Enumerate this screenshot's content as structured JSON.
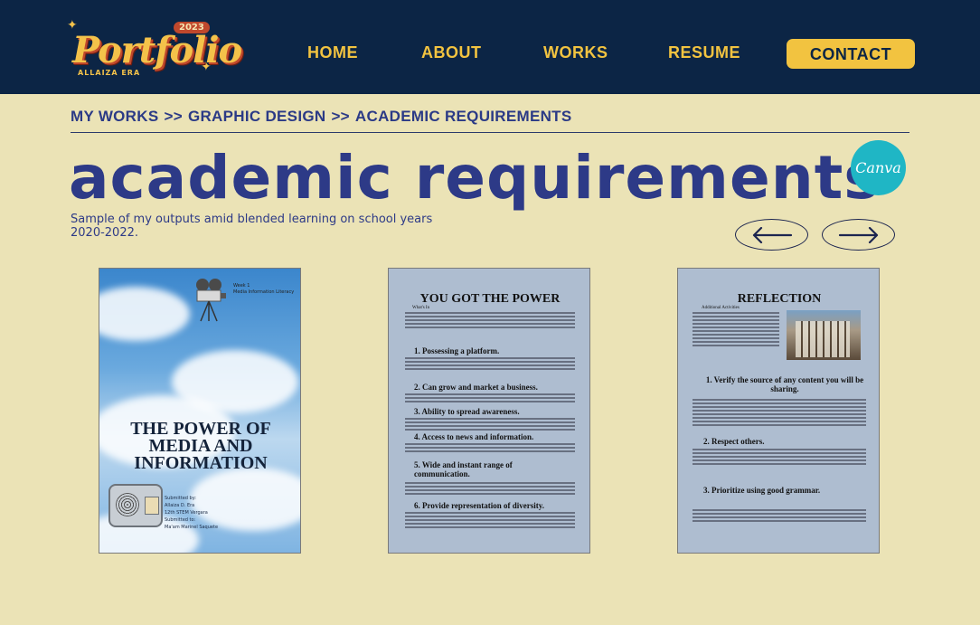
{
  "header": {
    "logo": {
      "word": "Portfolio",
      "year": "2023",
      "sub": "ALLAIZA ERA"
    },
    "nav": [
      "HOME",
      "ABOUT",
      "WORKS",
      "RESUME"
    ],
    "contact_label": "CONTACT"
  },
  "breadcrumb": [
    "MY WORKS",
    ">>",
    "GRAPHIC DESIGN",
    ">>",
    "ACADEMIC REQUIREMENTS"
  ],
  "page_title": "academic requirements",
  "canva_label": "Canva",
  "subtitle": "Sample of my outputs amid blended learning on school years 2020-2022.",
  "cards": {
    "cover": {
      "module": "Week 1",
      "module_sub": "Media Information Literacy",
      "title_lines": [
        "THE POWER OF",
        "MEDIA AND",
        "INFORMATION"
      ],
      "credits": [
        "Submitted by:",
        "Allaiza D. Era",
        "12th STEM Vergara",
        "Submitted to:",
        "Ma'am Marinel Saquete"
      ]
    },
    "power": {
      "title": "YOU GOT THE POWER",
      "intro_label": "What's In",
      "items": [
        "1. Possessing a platform.",
        "2. Can grow and market a business.",
        "3. Ability to spread awareness.",
        "4. Access to news and information.",
        "5. Wide and instant range of communication.",
        "6. Provide representation of diversity."
      ]
    },
    "reflection": {
      "title": "REFLECTION",
      "intro_label": "Additional Activities",
      "items": [
        "1. Verify the source of any content you will be sharing.",
        "2. Respect others.",
        "3. Prioritize using good grammar."
      ]
    }
  },
  "colors": {
    "navy": "#0c2545",
    "gold": "#f2c340",
    "cream": "#ebe3b6",
    "indigo": "#2d3a87",
    "canva": "#1fb6c5"
  },
  "icons": [
    "arrow-left-icon",
    "arrow-right-icon",
    "canva-logo"
  ]
}
